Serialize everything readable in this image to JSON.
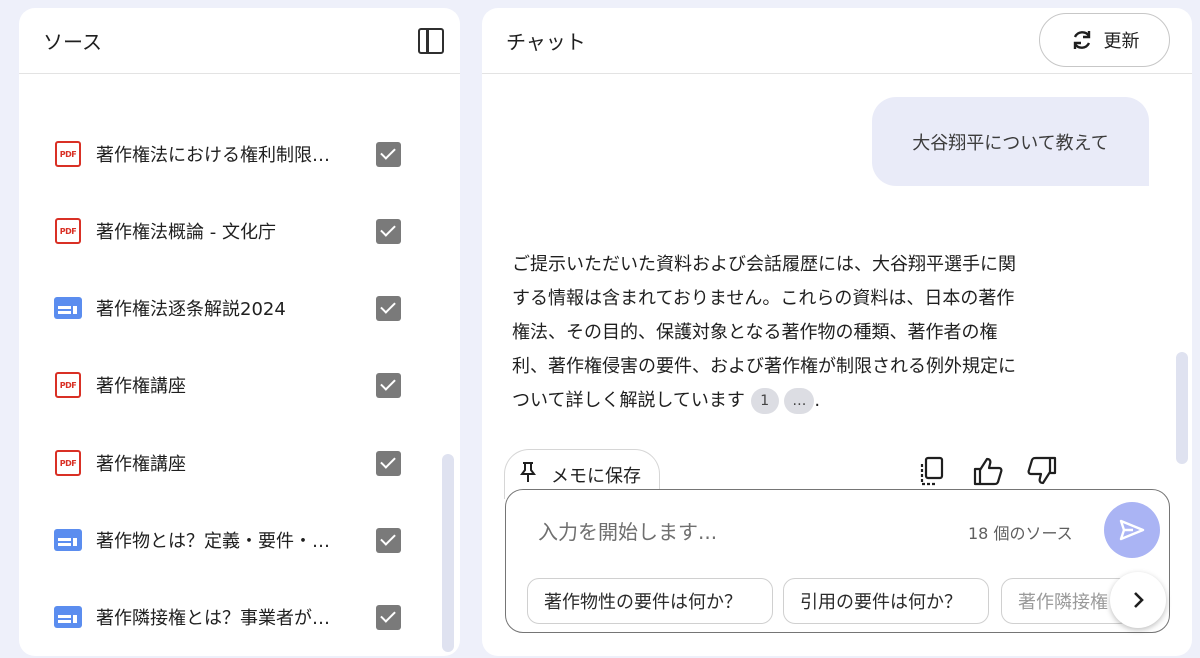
{
  "sources_panel": {
    "title": "ソース",
    "items": [
      {
        "type": "pdf",
        "label": "著作権法における権利制限…"
      },
      {
        "type": "pdf",
        "label": "著作権法概論 - 文化庁"
      },
      {
        "type": "web",
        "label": "著作権法逐条解説2024"
      },
      {
        "type": "pdf",
        "label": "著作権講座"
      },
      {
        "type": "pdf",
        "label": "著作権講座"
      },
      {
        "type": "web",
        "label": "著作物とは？定義・要件・…"
      },
      {
        "type": "web",
        "label": "著作隣接権とは？事業者が…"
      }
    ],
    "pdf_icon_text": "PDF"
  },
  "chat_panel": {
    "title": "チャット",
    "refresh_label": "更新",
    "user_message": "大谷翔平について教えて",
    "answer_lines": [
      "ご提示いただいた資料および会話履歴には、大谷翔平選手に関",
      "する情報は含まれておりません。これらの資料は、日本の著作",
      "権法、その目的、保護対象となる著作物の種類、著作者の権",
      "利、著作権侵害の要件、および著作権が制限される例外規定に",
      "ついて詳しく解説しています"
    ],
    "citation_1": "1",
    "citation_more": "…",
    "answer_end": ".",
    "save_note_label": "メモに保存",
    "input_placeholder": "入力を開始します...",
    "source_count": "18 個のソース",
    "suggestions": [
      "著作物性の要件は何か？",
      "引用の要件は何か？",
      "著作隣接権"
    ]
  },
  "colors": {
    "background": "#eef0fa",
    "pdf_red": "#d93025",
    "web_blue": "#5b8def",
    "send_button": "#aab4f4",
    "user_bubble": "#e9ebf8"
  }
}
